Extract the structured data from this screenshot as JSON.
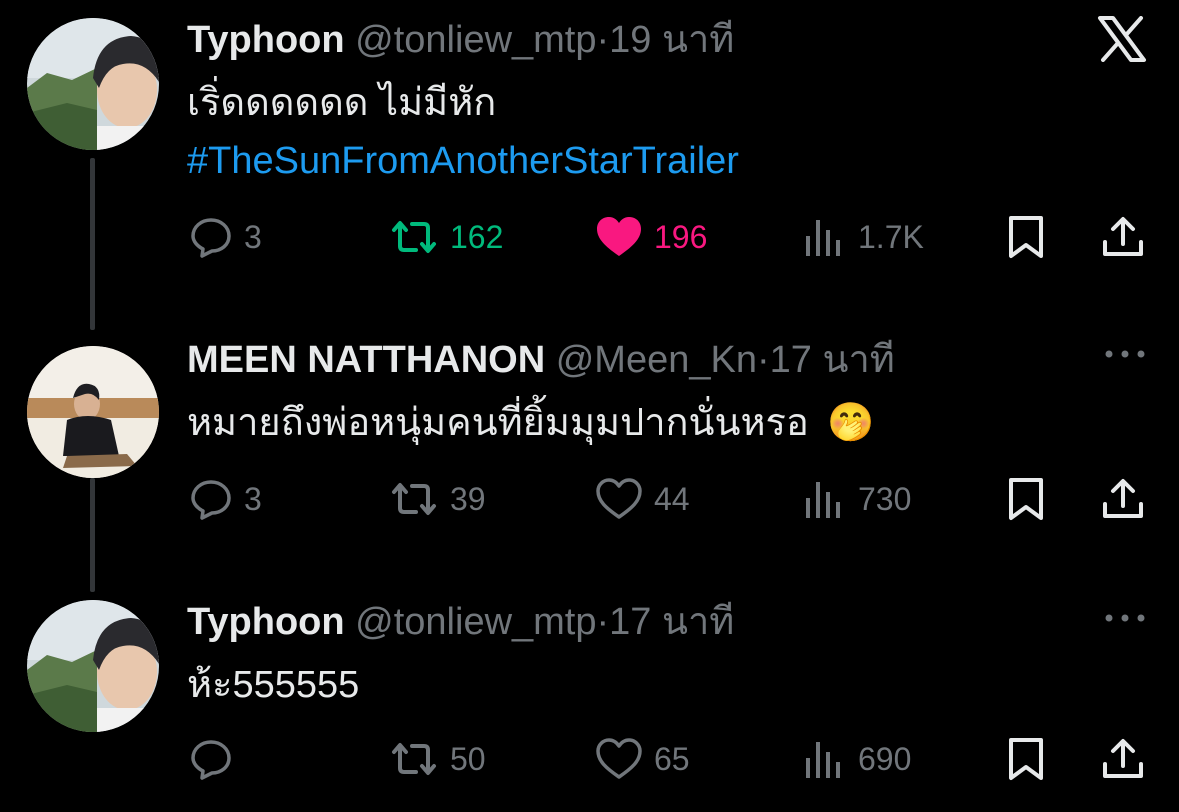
{
  "tweets": [
    {
      "name": "Typhoon",
      "handle": "@tonliew_mtp",
      "sep": "·",
      "time": "19 นาที",
      "text_line1": "เริ่ดดดดดด ไม่มีหัก",
      "hashtag": "#TheSunFromAnotherStarTrailer",
      "replies": "3",
      "reposts": "162",
      "likes": "196",
      "views": "1.7K",
      "reposted": true,
      "liked": true,
      "top_right_icon": "x-logo-icon"
    },
    {
      "name": "MEEN NATTHANON",
      "handle": "@Meen_Kn",
      "sep": "·",
      "time": "17 นาที",
      "text_line1": "หมายถึงพ่อหนุ่มคนที่ยิ้มมุมปากนั่นหรอ",
      "emoji": "🤭",
      "replies": "3",
      "reposts": "39",
      "likes": "44",
      "views": "730",
      "top_right_icon": "more-icon"
    },
    {
      "name": "Typhoon",
      "handle": "@tonliew_mtp",
      "sep": "·",
      "time": "17 นาที",
      "text_line1": "ห้ะ555555",
      "replies": "",
      "reposts": "50",
      "likes": "65",
      "views": "690",
      "top_right_icon": "more-icon"
    }
  ],
  "colors": {
    "background": "#000000",
    "text": "#e7e9ea",
    "muted": "#71767b",
    "link": "#1d9bf0",
    "repost_active": "#00ba7c",
    "like_active": "#f91880",
    "thread_line": "#333639"
  }
}
